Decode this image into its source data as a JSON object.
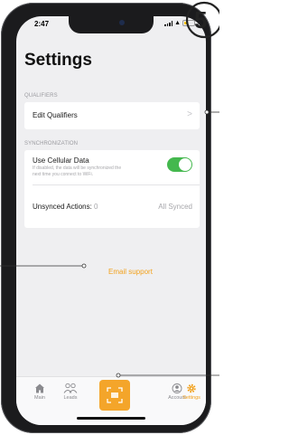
{
  "callout": {
    "number": "5"
  },
  "status_bar": {
    "time": "2:47"
  },
  "header": {
    "title": "Settings"
  },
  "sections": {
    "qualifiers": {
      "header": "QUALIFIERS",
      "edit_label": "Edit Qualifiers",
      "chevron": ">"
    },
    "synchronization": {
      "header": "SYNCHRONIZATION",
      "cellular_label": "Use Cellular Data",
      "cellular_sub_line1": "If disabled, the data will be synchronized the",
      "cellular_sub_line2": "next time you connect to WiFi.",
      "cellular_enabled": true,
      "unsynced_label": "Unsynced Actions:",
      "unsynced_count": "0",
      "unsynced_status": "All Synced"
    }
  },
  "support_link": "Email support",
  "tabbar": {
    "main": "Main",
    "leads": "Leads",
    "account": "Account",
    "settings": "Settings",
    "active": "settings"
  },
  "colors": {
    "accent": "#f2a11c",
    "toggle_on": "#44b84e",
    "background": "#efeff1"
  },
  "icons": {
    "main": "home-icon",
    "leads": "people-icon",
    "scan": "scan-icon",
    "account": "account-icon",
    "settings": "gear-icon"
  }
}
